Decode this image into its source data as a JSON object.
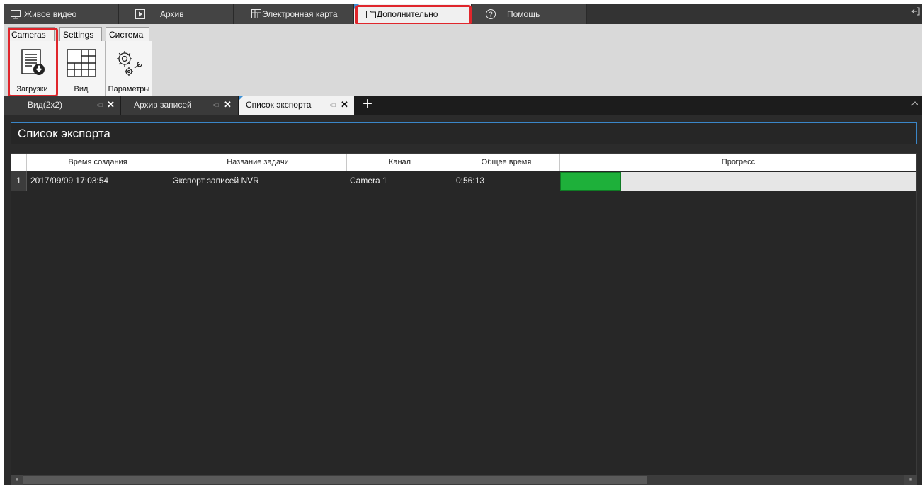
{
  "top_tabs": [
    {
      "label": "Живое видео",
      "icon": "monitor-icon"
    },
    {
      "label": "Архив",
      "icon": "play-icon"
    },
    {
      "label": "Электронная карта",
      "icon": "map-icon"
    },
    {
      "label": "Дополнительно",
      "icon": "folder-icon",
      "active": true
    },
    {
      "label": "Помощь",
      "icon": "help-icon"
    }
  ],
  "ribbon": {
    "tabs": [
      "Cameras",
      "Settings",
      "Система"
    ],
    "buttons": [
      {
        "label": "Загрузки",
        "icon": "download-list-icon"
      },
      {
        "label": "Вид",
        "icon": "grid-view-icon"
      },
      {
        "label": "Параметры",
        "icon": "settings-gears-icon"
      }
    ]
  },
  "doc_tabs": [
    {
      "label": "Вид(2x2)"
    },
    {
      "label": "Архив записей"
    },
    {
      "label": "Список экспорта",
      "active": true
    }
  ],
  "add_tab": "+",
  "page_title": "Список экспорта",
  "table": {
    "columns": [
      "Время создания",
      "Название задачи",
      "Канал",
      "Общее время",
      "Прогресс"
    ],
    "rows": [
      {
        "num": "1",
        "created": "2017/09/09 17:03:54",
        "task": "Экспорт записей NVR",
        "channel": "Camera 1",
        "duration": "0:56:13",
        "progress": 0.17
      }
    ]
  },
  "colors": {
    "accent": "#3a86c8",
    "highlight": "#e0262c",
    "progress": "#1eb03a"
  }
}
